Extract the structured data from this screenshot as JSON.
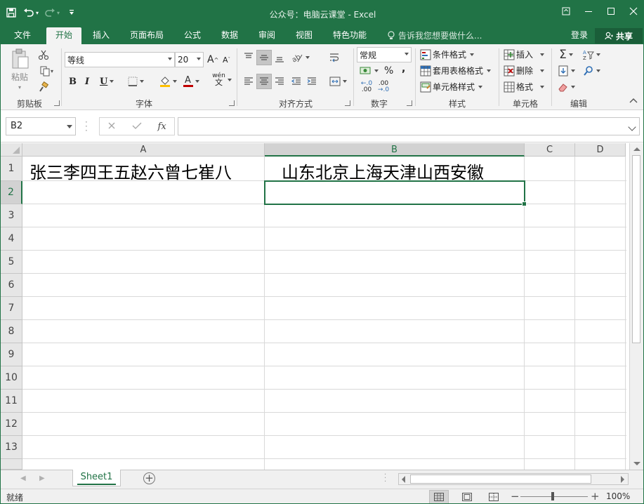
{
  "window": {
    "title": "公众号：电脑云课堂 - Excel",
    "accent": "#217346"
  },
  "qat": {
    "save_icon": "save-icon",
    "undo_icon": "undo-icon",
    "redo_icon": "redo-icon",
    "customize_icon": "customize-qat-icon"
  },
  "tabs": [
    {
      "label": "文件"
    },
    {
      "label": "开始"
    },
    {
      "label": "插入"
    },
    {
      "label": "页面布局"
    },
    {
      "label": "公式"
    },
    {
      "label": "数据"
    },
    {
      "label": "审阅"
    },
    {
      "label": "视图"
    },
    {
      "label": "特色功能"
    }
  ],
  "active_tab": "开始",
  "tellme": "告诉我您想要做什么...",
  "signin": "登录",
  "share": "共享",
  "ribbon": {
    "clipboard": {
      "paste": "粘贴",
      "label": "剪贴板"
    },
    "font": {
      "name": "等线",
      "size": "20",
      "grow": "A",
      "shrink": "A",
      "bold": "B",
      "italic": "I",
      "underline": "U",
      "phonetic": "wén",
      "font_color_letter": "A",
      "label": "字体"
    },
    "alignment": {
      "label": "对齐方式"
    },
    "number": {
      "format": "常规",
      "percent": "%",
      "comma": ",",
      "inc_decimal": ".00",
      "dec_decimal": ".00",
      "label": "数字"
    },
    "styles": {
      "conditional": "条件格式",
      "table": "套用表格格式",
      "cell": "单元格样式",
      "label": "样式"
    },
    "cells": {
      "insert": "插入",
      "delete": "删除",
      "format": "格式",
      "label": "单元格"
    },
    "editing": {
      "label": "编辑"
    }
  },
  "formula_bar": {
    "name_box": "B2",
    "formula": ""
  },
  "columns": [
    "A",
    "B",
    "C",
    "D"
  ],
  "rows": [
    "1",
    "2",
    "3",
    "4",
    "5",
    "6",
    "7",
    "8",
    "9",
    "10",
    "11",
    "12",
    "13"
  ],
  "cells": {
    "A1": "张三李四王五赵六曾七崔八",
    "B1": "山东北京上海天津山西安徽"
  },
  "active_cell": "B2",
  "sheets": [
    {
      "name": "Sheet1"
    }
  ],
  "status": {
    "ready": "就绪",
    "zoom": "100%"
  }
}
